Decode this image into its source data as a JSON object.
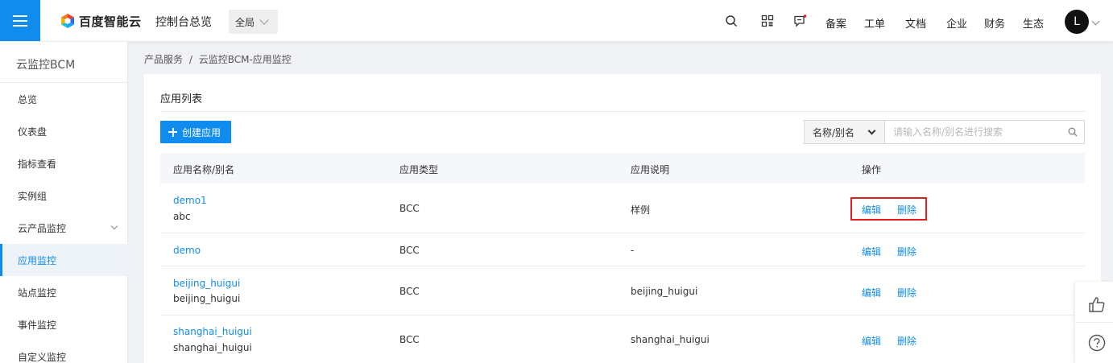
{
  "header": {
    "logo_text": "百度智能云",
    "console_title": "控制台总览",
    "region": "全局",
    "nav": [
      "备案",
      "工单",
      "文档",
      "企业",
      "财务",
      "生态"
    ],
    "avatar_initial": "L"
  },
  "sidebar": {
    "title": "云监控BCM",
    "items": [
      {
        "label": "总览"
      },
      {
        "label": "仪表盘"
      },
      {
        "label": "指标查看"
      },
      {
        "label": "实例组"
      },
      {
        "label": "云产品监控"
      },
      {
        "label": "应用监控"
      },
      {
        "label": "站点监控"
      },
      {
        "label": "事件监控"
      },
      {
        "label": "自定义监控"
      }
    ]
  },
  "breadcrumb": {
    "parent": "产品服务",
    "sep": "/",
    "current": "云监控BCM-应用监控"
  },
  "card": {
    "title": "应用列表",
    "create_label": "创建应用",
    "search_select": "名称/别名",
    "search_placeholder": "请输入名称/别名进行搜索"
  },
  "table": {
    "columns": [
      "应用名称/别名",
      "应用类型",
      "应用说明",
      "操作"
    ],
    "edit_label": "编辑",
    "delete_label": "删除",
    "rows": [
      {
        "name": "demo1",
        "alias": "abc",
        "type": "BCC",
        "desc": "样例"
      },
      {
        "name": "demo",
        "alias": "",
        "type": "BCC",
        "desc": "-"
      },
      {
        "name": "beijing_huigui",
        "alias": "beijing_huigui",
        "type": "BCC",
        "desc": "beijing_huigui"
      },
      {
        "name": "shanghai_huigui",
        "alias": "shanghai_huigui",
        "type": "BCC",
        "desc": "shanghai_huigui"
      }
    ]
  },
  "colors": {
    "primary": "#108cee",
    "highlight": "#e02020"
  }
}
